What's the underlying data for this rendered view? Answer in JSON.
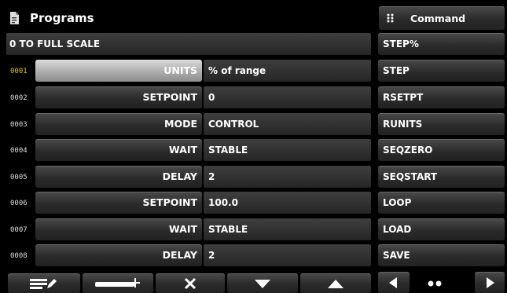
{
  "header": {
    "title": "Programs",
    "title_icon": "document-icon"
  },
  "command_header": {
    "label": "Command",
    "icon": "grid-dots-icon"
  },
  "program_name": "0 TO FULL SCALE",
  "rows": [
    {
      "num": "0001",
      "param": "UNITS",
      "value": "% of range",
      "selected": true
    },
    {
      "num": "0002",
      "param": "SETPOINT",
      "value": "0"
    },
    {
      "num": "0003",
      "param": "MODE",
      "value": "CONTROL"
    },
    {
      "num": "0004",
      "param": "WAIT",
      "value": "STABLE"
    },
    {
      "num": "0005",
      "param": "DELAY",
      "value": "2"
    },
    {
      "num": "0006",
      "param": "SETPOINT",
      "value": "100.0"
    },
    {
      "num": "0007",
      "param": "WAIT",
      "value": "STABLE"
    },
    {
      "num": "0008",
      "param": "DELAY",
      "value": "2"
    }
  ],
  "commands": [
    "STEP%",
    "STEP",
    "RSETPT",
    "RUNITS",
    "SEQZERO",
    "SEQSTART",
    "LOOP",
    "LOAD",
    "SAVE"
  ],
  "colors": {
    "selected_row_number": "#e3c400",
    "background": "#000000"
  },
  "toolbar_icons": [
    "edit-list-icon",
    "insert-step-icon",
    "delete-x-icon",
    "arrow-down-icon",
    "arrow-up-icon"
  ],
  "pager_icons": [
    "arrow-left-icon",
    "page-dots-icon",
    "arrow-right-icon"
  ]
}
